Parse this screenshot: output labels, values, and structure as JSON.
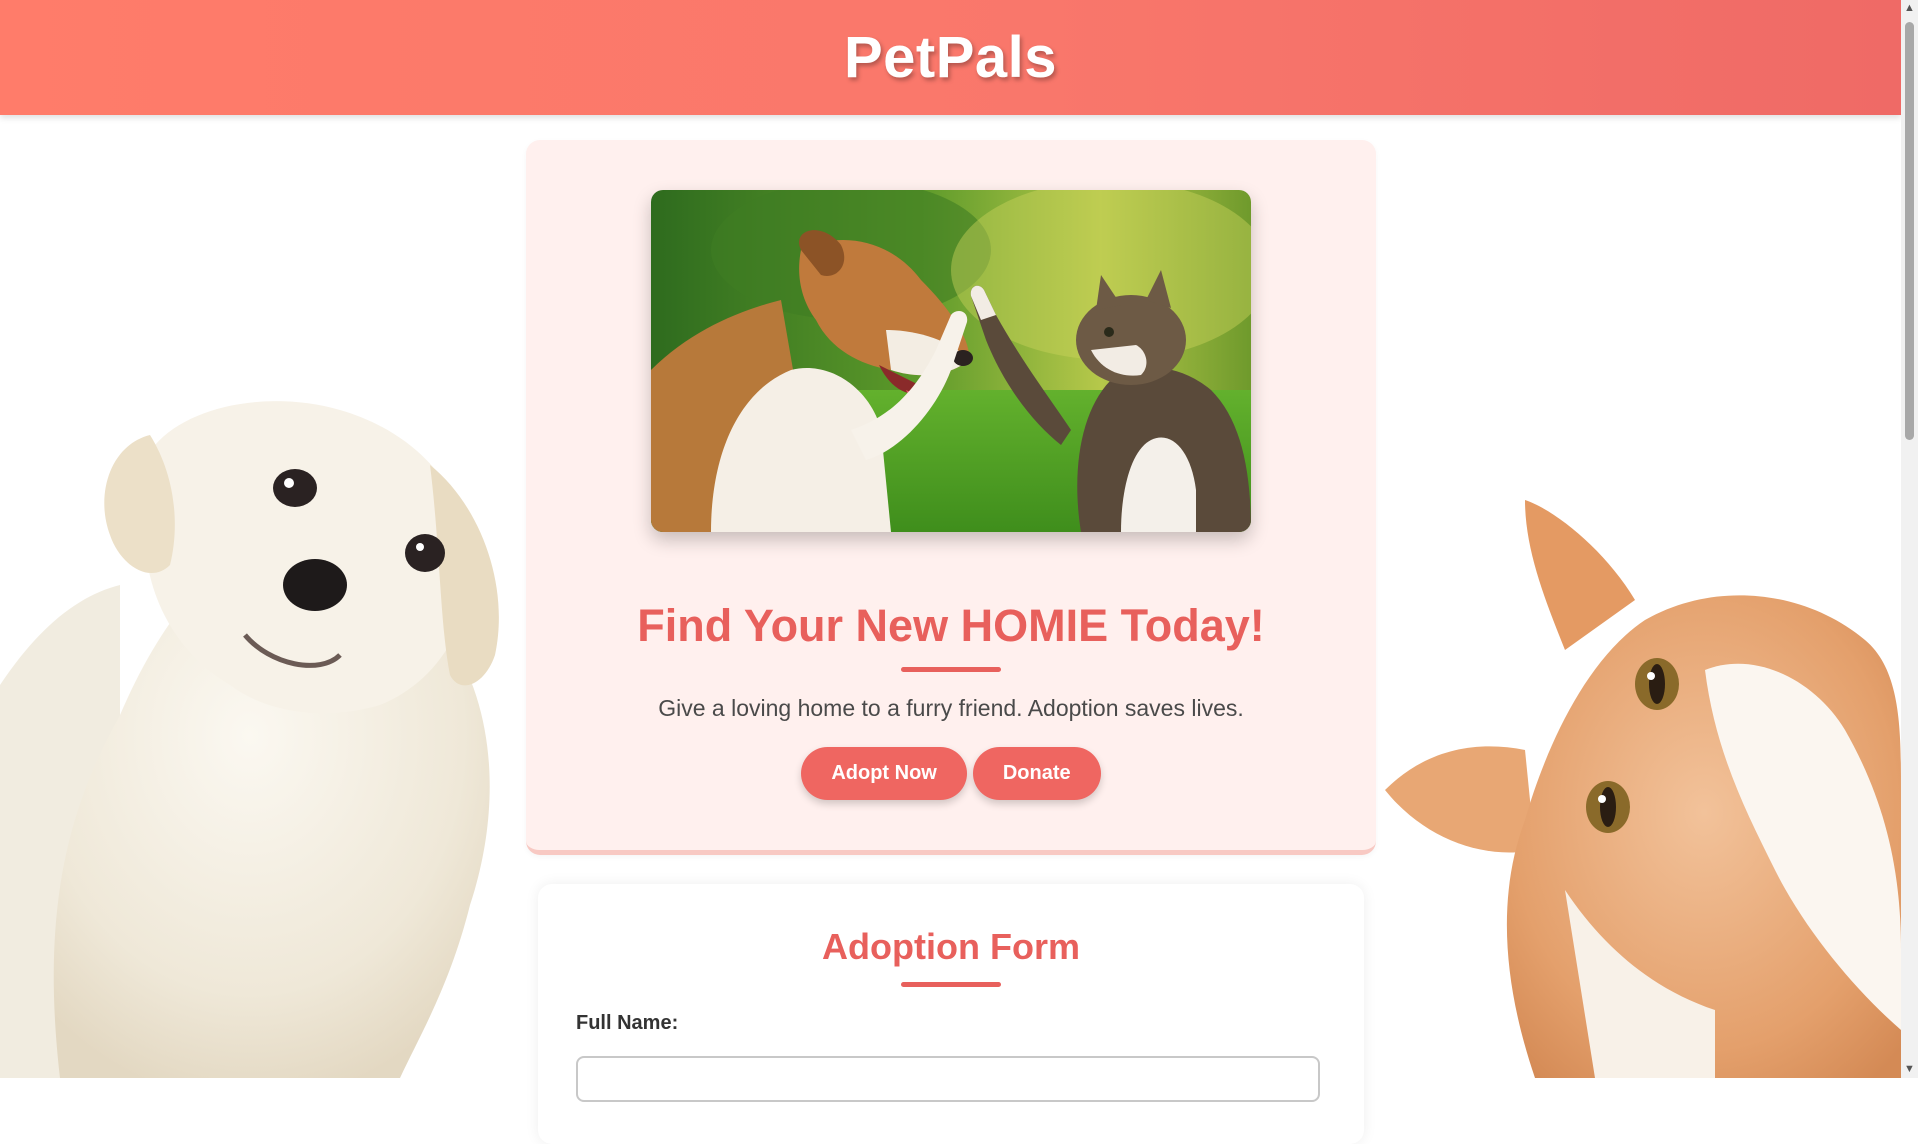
{
  "header": {
    "brand": "PetPals"
  },
  "hero": {
    "photo_icon": "dog-and-cat-high-five-photo",
    "title": "Find Your New HOMIE Today!",
    "subtitle": "Give a loving home to a furry friend. Adoption saves lives.",
    "buttons": {
      "adopt": "Adopt Now",
      "donate": "Donate"
    }
  },
  "form": {
    "title": "Adoption Form",
    "full_name_label": "Full Name:",
    "full_name_value": "",
    "full_name_placeholder": ""
  },
  "decor": {
    "left_icon": "white-puppy-illustration",
    "right_icon": "orange-kitten-illustration"
  },
  "colors": {
    "header": "#f9776b",
    "accent": "#e8605c",
    "button": "#ef6661",
    "hero_bg": "#fff0ee"
  }
}
